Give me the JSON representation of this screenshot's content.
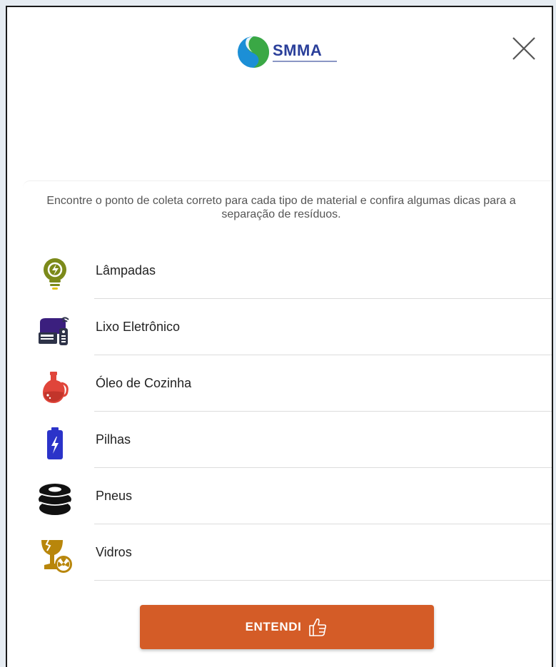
{
  "header": {
    "logo_text": "SMMA",
    "close_icon": "close-icon"
  },
  "intro": {
    "text": "Encontre o ponto de coleta correto para cada tipo de material e confira algumas dicas para a separação de resíduos."
  },
  "materials": [
    {
      "label": "Lâmpadas",
      "icon": "light-bulb-icon",
      "color": "#7c8a1a"
    },
    {
      "label": "Lixo Eletrônico",
      "icon": "electronics-icon",
      "color": "#3b1f7e"
    },
    {
      "label": "Óleo de Cozinha",
      "icon": "oil-jug-icon",
      "color": "#e0453a"
    },
    {
      "label": "Pilhas",
      "icon": "battery-icon",
      "color": "#2b33c9"
    },
    {
      "label": "Pneus",
      "icon": "tire-icon",
      "color": "#111111"
    },
    {
      "label": "Vidros",
      "icon": "broken-glass-icon",
      "color": "#b8860b"
    }
  ],
  "footer": {
    "button_label": "ENTENDI",
    "button_icon": "thumbs-up-icon",
    "button_color": "#d45c27"
  }
}
